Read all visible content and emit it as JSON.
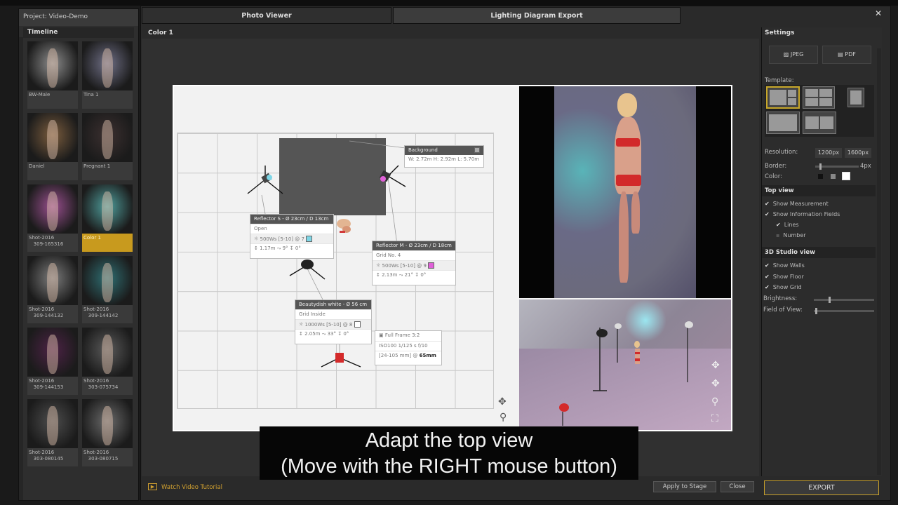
{
  "project": {
    "title": "Project: Video-Demo",
    "timeline_label": "Timeline",
    "thumbnails": [
      {
        "label": "BW-Male",
        "tone": "#8c8c8c"
      },
      {
        "label": "Tina 1",
        "tone": "#6f6f86"
      },
      {
        "label": "Daniel",
        "tone": "#7a5c3d"
      },
      {
        "label": "Pregnant 1",
        "tone": "#3c3030"
      },
      {
        "label": "Shot-2016\n   309-165316",
        "tone": "#9a4f8f"
      },
      {
        "label": "Color 1",
        "tone": "#4f9e9c",
        "selected": true
      },
      {
        "label": "Shot-2016\n   309-144132",
        "tone": "#7b7b7b"
      },
      {
        "label": "Shot-2016\n   309-144142",
        "tone": "#2f6f73"
      },
      {
        "label": "Shot-2016\n   309-144153",
        "tone": "#4d2246"
      },
      {
        "label": "Shot-2016\n   303-075734",
        "tone": "#5a5a5a"
      },
      {
        "label": "Shot-2016\n   303-080145",
        "tone": "#4d4d4d"
      },
      {
        "label": "Shot-2016\n   303-080715",
        "tone": "#6a6a6a"
      }
    ]
  },
  "tabs": {
    "photo_viewer": "Photo Viewer",
    "lighting_export": "Lighting Diagram Export"
  },
  "close_glyph": "✕",
  "view_title": "Color 1",
  "diagram": {
    "background": {
      "title": "Background",
      "dims": "W: 2.72m  H: 2.92m  L: 5.70m"
    },
    "reflector_s": {
      "title": "Reflector S - Ø 23cm / D 13cm",
      "mod": "Open",
      "power": "500Ws [5-10] @ 7",
      "dist": "1.17m",
      "angle": "9°",
      "tilt": "0°",
      "color": "#7ed6e6"
    },
    "reflector_m": {
      "title": "Reflector M - Ø 23cm / D 18cm",
      "mod": "Grid No. 4",
      "power": "500Ws [5-10] @ 9",
      "dist": "2.13m",
      "angle": "21°",
      "tilt": "0°",
      "color": "#e060d8"
    },
    "beautydish": {
      "title": "Beautydish white - Ø 56 cm",
      "mod": "Grid Inside",
      "power": "1000Ws [5-10] @ 8",
      "dist": "2.05m",
      "angle": "33°",
      "tilt": "0°",
      "color": "#ffffff"
    },
    "camera": {
      "format": "Full Frame    3:2",
      "settings": "ISO100   1/125 s   f/10",
      "lens": "[24-105 mm] @",
      "focal": "65mm"
    }
  },
  "subtitle": {
    "line1": "Adapt the top view",
    "line2": "(Move with the RIGHT mouse button)"
  },
  "bottom": {
    "tutorial": "Watch Video Tutorial",
    "apply": "Apply to Stage",
    "close": "Close",
    "export": "EXPORT"
  },
  "settings": {
    "title": "Settings",
    "jpeg": "JPEG",
    "pdf": "PDF",
    "template_label": "Template:",
    "resolution_label": "Resolution:",
    "res_1": "1200px",
    "res_2": "1600px",
    "border_label": "Border:",
    "border_value": "4px",
    "border_level": 0.1,
    "color_label": "Color:",
    "colors": [
      "#111111",
      "#888888",
      "#ffffff"
    ],
    "top_view": "Top view",
    "show_measurement": "Show Measurement",
    "show_info": "Show Information Fields",
    "lines": "Lines",
    "number": "Number",
    "studio_view": "3D Studio view",
    "show_walls": "Show Walls",
    "show_floor": "Show Floor",
    "show_grid": "Show Grid",
    "brightness_label": "Brightness:",
    "brightness_level": 0.25,
    "fov_label": "Field of View:",
    "fov_level": 0.02
  }
}
